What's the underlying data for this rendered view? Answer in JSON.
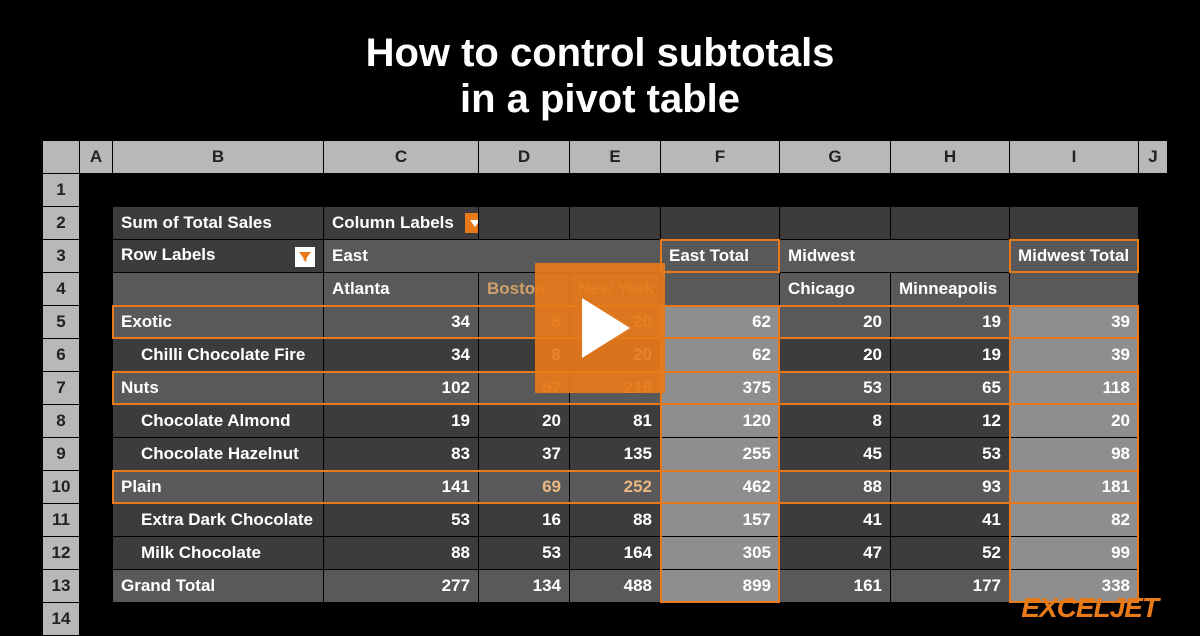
{
  "title_l1": "How to control subtotals",
  "title_l2": "in a pivot table",
  "columns": [
    "A",
    "B",
    "C",
    "D",
    "E",
    "F",
    "G",
    "H",
    "I",
    "J"
  ],
  "row_numbers": [
    "1",
    "2",
    "3",
    "4",
    "5",
    "6",
    "7",
    "8",
    "9",
    "10",
    "11",
    "12",
    "13",
    "14"
  ],
  "r2": {
    "b": "Sum of Total Sales",
    "c": "Column Labels"
  },
  "r3": {
    "b": "Row Labels",
    "c": "East",
    "f": "East Total",
    "g": "Midwest",
    "i": "Midwest Total"
  },
  "r4": {
    "c": "Atlanta",
    "d": "Boston",
    "e": "New York",
    "g": "Chicago",
    "h": "Minneapolis"
  },
  "rows": [
    {
      "label": "Exotic",
      "indent": false,
      "hl": true,
      "c": "34",
      "d": "8",
      "e": "20",
      "f": "62",
      "g": "20",
      "h": "19",
      "i": "39"
    },
    {
      "label": "Chilli Chocolate Fire",
      "indent": true,
      "hl": false,
      "c": "34",
      "d": "8",
      "e": "20",
      "f": "62",
      "g": "20",
      "h": "19",
      "i": "39"
    },
    {
      "label": "Nuts",
      "indent": false,
      "hl": true,
      "c": "102",
      "d": "57",
      "e": "216",
      "f": "375",
      "g": "53",
      "h": "65",
      "i": "118"
    },
    {
      "label": "Chocolate Almond",
      "indent": true,
      "hl": false,
      "c": "19",
      "d": "20",
      "e": "81",
      "f": "120",
      "g": "8",
      "h": "12",
      "i": "20"
    },
    {
      "label": "Chocolate Hazelnut",
      "indent": true,
      "hl": false,
      "c": "83",
      "d": "37",
      "e": "135",
      "f": "255",
      "g": "45",
      "h": "53",
      "i": "98"
    },
    {
      "label": "Plain",
      "indent": false,
      "hl": true,
      "c": "141",
      "d": "69",
      "e": "252",
      "f": "462",
      "g": "88",
      "h": "93",
      "i": "181"
    },
    {
      "label": "Extra Dark Chocolate",
      "indent": true,
      "hl": false,
      "c": "53",
      "d": "16",
      "e": "88",
      "f": "157",
      "g": "41",
      "h": "41",
      "i": "82"
    },
    {
      "label": "Milk Chocolate",
      "indent": true,
      "hl": false,
      "c": "88",
      "d": "53",
      "e": "164",
      "f": "305",
      "g": "47",
      "h": "52",
      "i": "99"
    }
  ],
  "grand": {
    "label": "Grand Total",
    "c": "277",
    "d": "134",
    "e": "488",
    "f": "899",
    "g": "161",
    "h": "177",
    "i": "338"
  },
  "brand": "EXCELJET"
}
